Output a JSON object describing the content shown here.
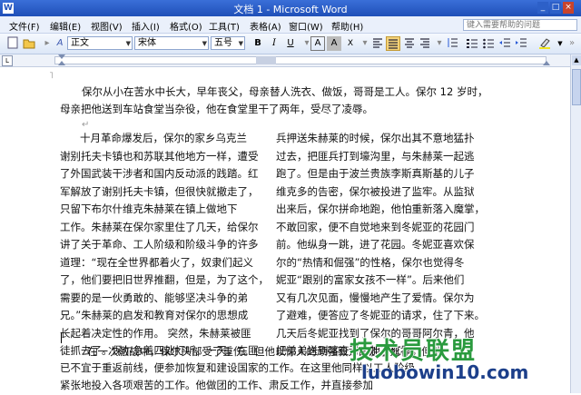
{
  "window": {
    "title": "文档 1 - Microsoft Word",
    "icon": "word-icon",
    "controls": [
      "_",
      "□",
      "×"
    ]
  },
  "menu": {
    "items": [
      "文件(F)",
      "编辑(E)",
      "视图(V)",
      "插入(I)",
      "格式(O)",
      "工具(T)",
      "表格(A)",
      "窗口(W)",
      "帮助(H)"
    ],
    "help_search": "键入需要帮助的问题"
  },
  "toolbar": {
    "style": "正文",
    "font": "宋体",
    "size": "五号",
    "bold": "B",
    "italic": "I",
    "underline": "U",
    "char_border": "A",
    "char_shading": "A",
    "scale": "X"
  },
  "document": {
    "intro": [
      "保尔从小在苦水中长大，早年丧父，母亲替人洗衣、做饭，哥哥是工人。保尔 12 岁时，",
      "母亲把他送到车站食堂当杂役，他在食堂里干了两年，受尽了凌辱。"
    ],
    "col1": [
      "十月革命爆发后，保尔的家乡乌克兰",
      "谢别托夫卡镇也和苏联其他地方一样，遭受",
      "了外国武装干涉者和国内反动派的践踏。红",
      "军解放了谢别托夫卡镇，但很快就撤走了，",
      "只留下布尔什维克朱赫莱在镇上做地下",
      "工作。朱赫莱在保尔家里住了几天，给保尔",
      "讲了关于革命、工人阶级和阶级斗争的许多",
      "道理：“现在全世界都着火了，奴隶们起义",
      "了，他们要把旧世界推翻，但是，为了这个，",
      "需要的是一伙勇敢的、能够坚决斗争的弟",
      "兄。”朱赫莱的启发和教育对保尔的思想成",
      "长起着决定性的作用。  突然，朱赫莱被匪",
      "徒抓去了。保尔急着四处打听。一天，在匪"
    ],
    "col2": [
      "兵押送朱赫莱的时候，保尔出其不意地猛扑",
      "过去，把匪兵打到壕沟里，与朱赫莱一起逃",
      "跑了。但是由于波兰贵族李斯真斯基的儿子",
      "维克多的告密，保尔被投进了监牢。从监狱",
      "出来后，保尔拼命地跑，他怕重新落入魔掌，",
      "不敢回家，便不自觉地来到冬妮亚的花园门",
      "前。他纵身一跳，进了花园。冬妮亚喜欢保",
      "尔的“热情和倔强”的性格，保尔也觉得冬",
      "妮亚“跟别的富家女孩不一样”。后来他们",
      "又有几次见面，慢慢地产生了爱情。保尔为",
      "了避难，便答应了冬妮亚的请求，住了下来。",
      "几天后冬妮亚找到了保尔的哥哥阿尔青，他",
      "把弟弟送到喀查了参加了红军。"
    ],
    "bottom": [
      "在一次激战中，保尔头部受了重伤。但他以惊人的顽强毅力战胜了死神。但他",
      "已不宜于重返前线，便参加恢复和建设国家的工作。在这里他同样以工人阶级",
      "紧张地投入各项艰苦的工作。他做团的工作、肃反工作，并直接参加"
    ]
  },
  "watermark": {
    "line1": "技术员联盟",
    "line2": "luobowin10.com"
  },
  "colors": {
    "title_bar": "#1f4fb8",
    "watermark_green": "#2a9a3e",
    "watermark_blue": "#1c3f8a"
  }
}
